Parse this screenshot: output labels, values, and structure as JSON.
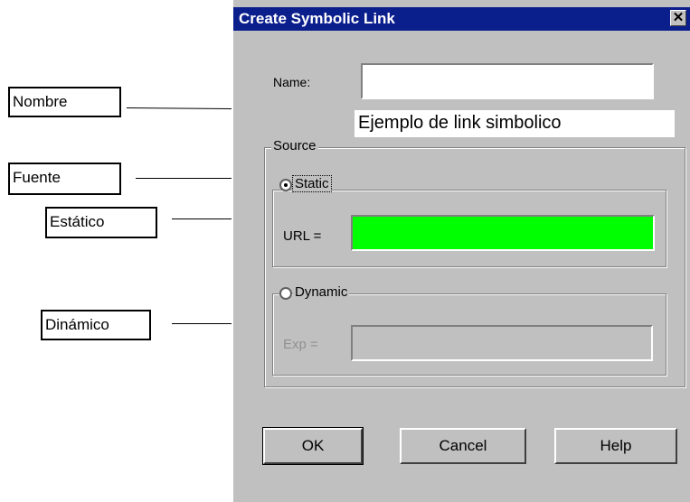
{
  "dialog": {
    "title": "Create Symbolic Link",
    "close_symbol": "✕",
    "name_label": "Name:",
    "name_value": "",
    "annotation_text": "Ejemplo de link simbolico",
    "source_label": "Source",
    "static_label": "Static",
    "url_label": "URL =",
    "url_value": "",
    "url_field_color": "#00ff00",
    "dynamic_label": "Dynamic",
    "exp_label": "Exp =",
    "exp_value": "",
    "static_selected": true,
    "buttons": {
      "ok": "OK",
      "cancel": "Cancel",
      "help": "Help"
    }
  },
  "callouts": {
    "nombre": "Nombre",
    "fuente": "Fuente",
    "estatico": "Estático",
    "dinamico": "Dinámico"
  },
  "colors": {
    "titlebar": "#0a1e8c",
    "dialog_bg": "#c0c0c0"
  }
}
